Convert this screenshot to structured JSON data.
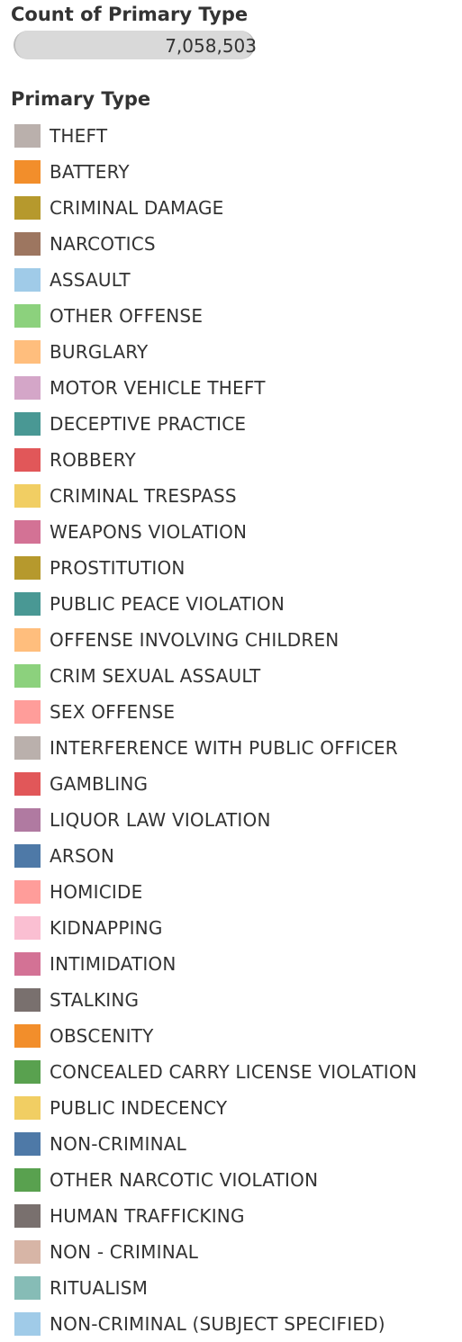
{
  "size_legend": {
    "title": "Count of Primary Type",
    "value": "7,058,503"
  },
  "color_legend": {
    "title": "Primary Type",
    "items": [
      {
        "label": "THEFT",
        "color": "#bab0ac"
      },
      {
        "label": "BATTERY",
        "color": "#f28e2b"
      },
      {
        "label": "CRIMINAL DAMAGE",
        "color": "#b6992d"
      },
      {
        "label": "NARCOTICS",
        "color": "#9d7660"
      },
      {
        "label": "ASSAULT",
        "color": "#a0cbe8"
      },
      {
        "label": "OTHER OFFENSE",
        "color": "#8cd17d"
      },
      {
        "label": "BURGLARY",
        "color": "#ffbe7d"
      },
      {
        "label": "MOTOR VEHICLE THEFT",
        "color": "#d4a6c8"
      },
      {
        "label": "DECEPTIVE PRACTICE",
        "color": "#499894"
      },
      {
        "label": "ROBBERY",
        "color": "#e15759"
      },
      {
        "label": "CRIMINAL TRESPASS",
        "color": "#f1ce63"
      },
      {
        "label": "WEAPONS VIOLATION",
        "color": "#d37295"
      },
      {
        "label": "PROSTITUTION",
        "color": "#b6992d"
      },
      {
        "label": "PUBLIC PEACE VIOLATION",
        "color": "#499894"
      },
      {
        "label": "OFFENSE INVOLVING CHILDREN",
        "color": "#ffbe7d"
      },
      {
        "label": "CRIM SEXUAL ASSAULT",
        "color": "#8cd17d"
      },
      {
        "label": "SEX OFFENSE",
        "color": "#ff9d9a"
      },
      {
        "label": "INTERFERENCE WITH PUBLIC OFFICER",
        "color": "#bab0ac"
      },
      {
        "label": "GAMBLING",
        "color": "#e15759"
      },
      {
        "label": "LIQUOR LAW VIOLATION",
        "color": "#b07aa1"
      },
      {
        "label": "ARSON",
        "color": "#4e79a7"
      },
      {
        "label": "HOMICIDE",
        "color": "#ff9d9a"
      },
      {
        "label": "KIDNAPPING",
        "color": "#fabfd2"
      },
      {
        "label": "INTIMIDATION",
        "color": "#d37295"
      },
      {
        "label": "STALKING",
        "color": "#79706e"
      },
      {
        "label": "OBSCENITY",
        "color": "#f28e2b"
      },
      {
        "label": "CONCEALED CARRY LICENSE VIOLATION",
        "color": "#59a14f"
      },
      {
        "label": "PUBLIC INDECENCY",
        "color": "#f1ce63"
      },
      {
        "label": "NON-CRIMINAL",
        "color": "#4e79a7"
      },
      {
        "label": "OTHER NARCOTIC VIOLATION",
        "color": "#59a14f"
      },
      {
        "label": "HUMAN TRAFFICKING",
        "color": "#79706e"
      },
      {
        "label": "NON - CRIMINAL",
        "color": "#d7b5a6"
      },
      {
        "label": "RITUALISM",
        "color": "#86bcb6"
      },
      {
        "label": "NON-CRIMINAL (SUBJECT SPECIFIED)",
        "color": "#a0cbe8"
      }
    ]
  }
}
